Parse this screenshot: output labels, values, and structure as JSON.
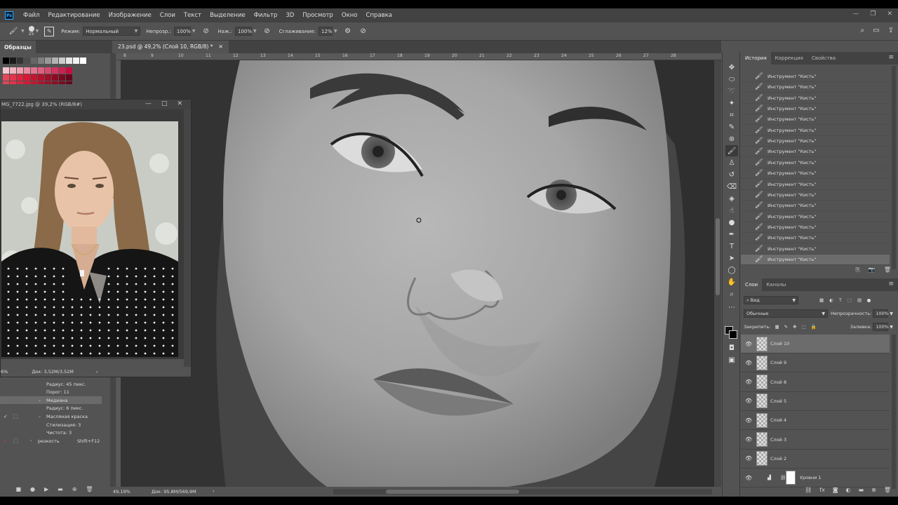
{
  "menu": {
    "items": [
      "Файл",
      "Редактирование",
      "Изображение",
      "Слои",
      "Текст",
      "Выделение",
      "Фильтр",
      "3D",
      "Просмотр",
      "Окно",
      "Справка"
    ]
  },
  "options": {
    "brush_size": "25",
    "mode_label": "Режим:",
    "mode_value": "Нормальный",
    "opacity_label": "Непрозр.:",
    "opacity_value": "100%",
    "pressure_label": "Наж.:",
    "pressure_value": "100%",
    "smoothing_label": "Сглаживание:",
    "smoothing_value": "12%"
  },
  "swatches": {
    "title": "Образцы",
    "grays": [
      "#000000",
      "#1a1a1a",
      "#333333",
      "#4d4d4d",
      "#666666",
      "#808080",
      "#999999",
      "#b3b3b3",
      "#cccccc",
      "#e6e6e6",
      "#f2f2f2",
      "#ffffff"
    ],
    "reds": [
      [
        "#f4c7d0",
        "#f1b3c0",
        "#ee9fb0",
        "#e98aa0",
        "#e47590",
        "#de6080",
        "#d84b70",
        "#d23660",
        "#cc2150",
        "#c60c40"
      ],
      [
        "#e6465a",
        "#e2354d",
        "#de2440",
        "#d81833",
        "#c51530",
        "#b2122c",
        "#9f0f28",
        "#8c0c24",
        "#790920",
        "#66061c"
      ]
    ]
  },
  "ref_window": {
    "title": "MG_7722.jpg @ 39,2% (RGB/8#)",
    "zoom": "6%",
    "doc_size": "Док: 3,52M/3,52M"
  },
  "history_left": {
    "rows": [
      {
        "text": "Радиус:  45 пикс.",
        "indent": true
      },
      {
        "text": "Порог:  11",
        "indent": true
      },
      {
        "text": "Медиана",
        "indent": false,
        "selected": true
      },
      {
        "text": "Радиус:  6 пикс.",
        "indent": true
      },
      {
        "text": "Масляная краска",
        "indent": false,
        "checked": true
      },
      {
        "text": "Стилизация:  3",
        "indent": true
      },
      {
        "text": "Чистота:  3",
        "indent": true
      },
      {
        "text": "резкость",
        "indent": false,
        "shortcut": "Shift+F12",
        "red": true
      }
    ]
  },
  "document": {
    "tab_title": "23.psd @ 49,2% (Слой 10, RGB/8) *",
    "zoom": "49,19%",
    "doc_size": "Док: 95,8M/569,9M",
    "ruler_labels": [
      "8",
      "9",
      "10",
      "11",
      "12",
      "13",
      "14",
      "15",
      "16",
      "17",
      "18",
      "19",
      "20",
      "21",
      "22",
      "23",
      "24",
      "25",
      "26",
      "27",
      "28"
    ]
  },
  "history": {
    "tabs": [
      "История",
      "Коррекция",
      "Свойства"
    ],
    "rows": [
      "Инструмент \"Кисть\"",
      "Инструмент \"Кисть\"",
      "Инструмент \"Кисть\"",
      "Инструмент \"Кисть\"",
      "Инструмент \"Кисть\"",
      "Инструмент \"Кисть\"",
      "Инструмент \"Кисть\"",
      "Инструмент \"Кисть\"",
      "Инструмент \"Кисть\"",
      "Инструмент \"Кисть\"",
      "Инструмент \"Кисть\"",
      "Инструмент \"Кисть\"",
      "Инструмент \"Кисть\"",
      "Инструмент \"Кисть\"",
      "Инструмент \"Кисть\"",
      "Инструмент \"Кисть\"",
      "Инструмент \"Кисть\"",
      "Инструмент \"Кисть\""
    ]
  },
  "layers": {
    "tabs": [
      "Слои",
      "Каналы"
    ],
    "filter_value": "Вид",
    "blend_mode": "Обычные",
    "opacity_label": "Непрозрачность:",
    "opacity_value": "100%",
    "lock_label": "Закрепить:",
    "fill_label": "Заливка:",
    "fill_value": "100%",
    "items": [
      {
        "name": "Слой 10",
        "selected": true
      },
      {
        "name": "Слой 9"
      },
      {
        "name": "Слой 8"
      },
      {
        "name": "Слой 5"
      },
      {
        "name": "Слой 4"
      },
      {
        "name": "Слой 3"
      },
      {
        "name": "Слой 2"
      },
      {
        "name": "Уровни 1",
        "adjustment": true
      }
    ]
  }
}
